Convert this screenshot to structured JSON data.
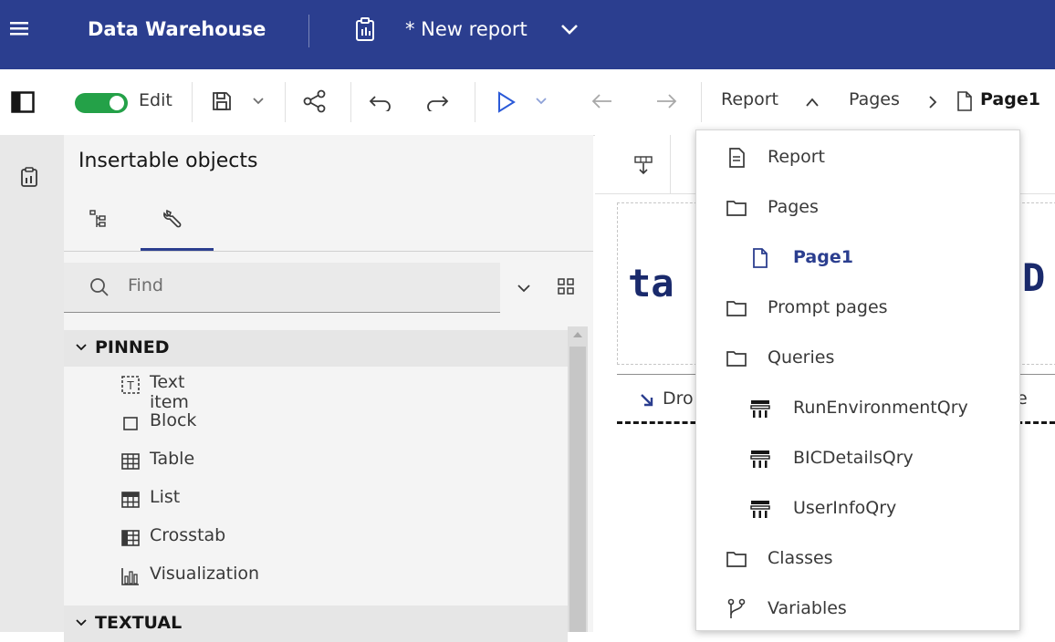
{
  "header": {
    "app_title": "Data Warehouse",
    "report_title": "* New report"
  },
  "toolbar": {
    "edit_label": "Edit",
    "breadcrumb": {
      "report": "Report",
      "pages": "Pages",
      "page": "Page1"
    }
  },
  "panel": {
    "title": "Insertable objects",
    "search_placeholder": "Find",
    "sections": {
      "pinned": "PINNED",
      "textual": "TEXTUAL"
    },
    "pinned_items": [
      {
        "label": "Text item",
        "icon": "text-item-icon"
      },
      {
        "label": "Block",
        "icon": "block-icon"
      },
      {
        "label": "Table",
        "icon": "table-icon"
      },
      {
        "label": "List",
        "icon": "list-icon"
      },
      {
        "label": "Crosstab",
        "icon": "crosstab-icon"
      },
      {
        "label": "Visualization",
        "icon": "visualization-icon"
      }
    ]
  },
  "canvas": {
    "big_text_left": "ta",
    "big_text_right": "D",
    "drop_label": "Dro",
    "right_fragment": "e"
  },
  "dropdown": {
    "items": [
      {
        "label": "Report",
        "icon": "document-icon"
      },
      {
        "label": "Pages",
        "icon": "folder-icon"
      },
      {
        "label": "Page1",
        "icon": "page-icon"
      },
      {
        "label": "Prompt pages",
        "icon": "folder-icon"
      },
      {
        "label": "Queries",
        "icon": "folder-icon"
      },
      {
        "label": "RunEnvironmentQry",
        "icon": "query-icon"
      },
      {
        "label": "BICDetailsQry",
        "icon": "query-icon"
      },
      {
        "label": "UserInfoQry",
        "icon": "query-icon"
      },
      {
        "label": "Classes",
        "icon": "folder-icon"
      },
      {
        "label": "Variables",
        "icon": "branch-icon"
      }
    ]
  },
  "colors": {
    "header_bg": "#2b3e8f",
    "toggle_on": "#24a148",
    "selected_text": "#2b3e8f",
    "run_blue": "#2b5ad8"
  }
}
